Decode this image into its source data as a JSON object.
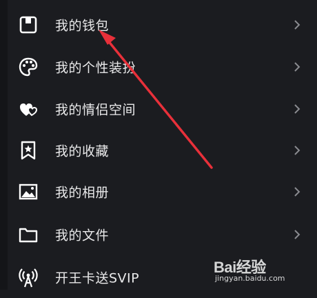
{
  "menu": {
    "items": [
      {
        "label": "我的钱包",
        "icon": "wallet-icon"
      },
      {
        "label": "我的个性装扮",
        "icon": "palette-icon"
      },
      {
        "label": "我的情侣空间",
        "icon": "hearts-icon"
      },
      {
        "label": "我的收藏",
        "icon": "bookmark-star-icon"
      },
      {
        "label": "我的相册",
        "icon": "photo-icon"
      },
      {
        "label": "我的文件",
        "icon": "folder-icon"
      },
      {
        "label": "开王卡送SVIP",
        "icon": "signal-tower-icon"
      }
    ]
  },
  "annotation": {
    "color": "#e8303a"
  },
  "watermark": {
    "brand": "Bai经验",
    "site": "jingyan.baidu.com"
  },
  "colors": {
    "background": "#1b1c20",
    "text": "#e9e9ea",
    "icon": "#ffffff",
    "chevron": "#8a8b90"
  }
}
